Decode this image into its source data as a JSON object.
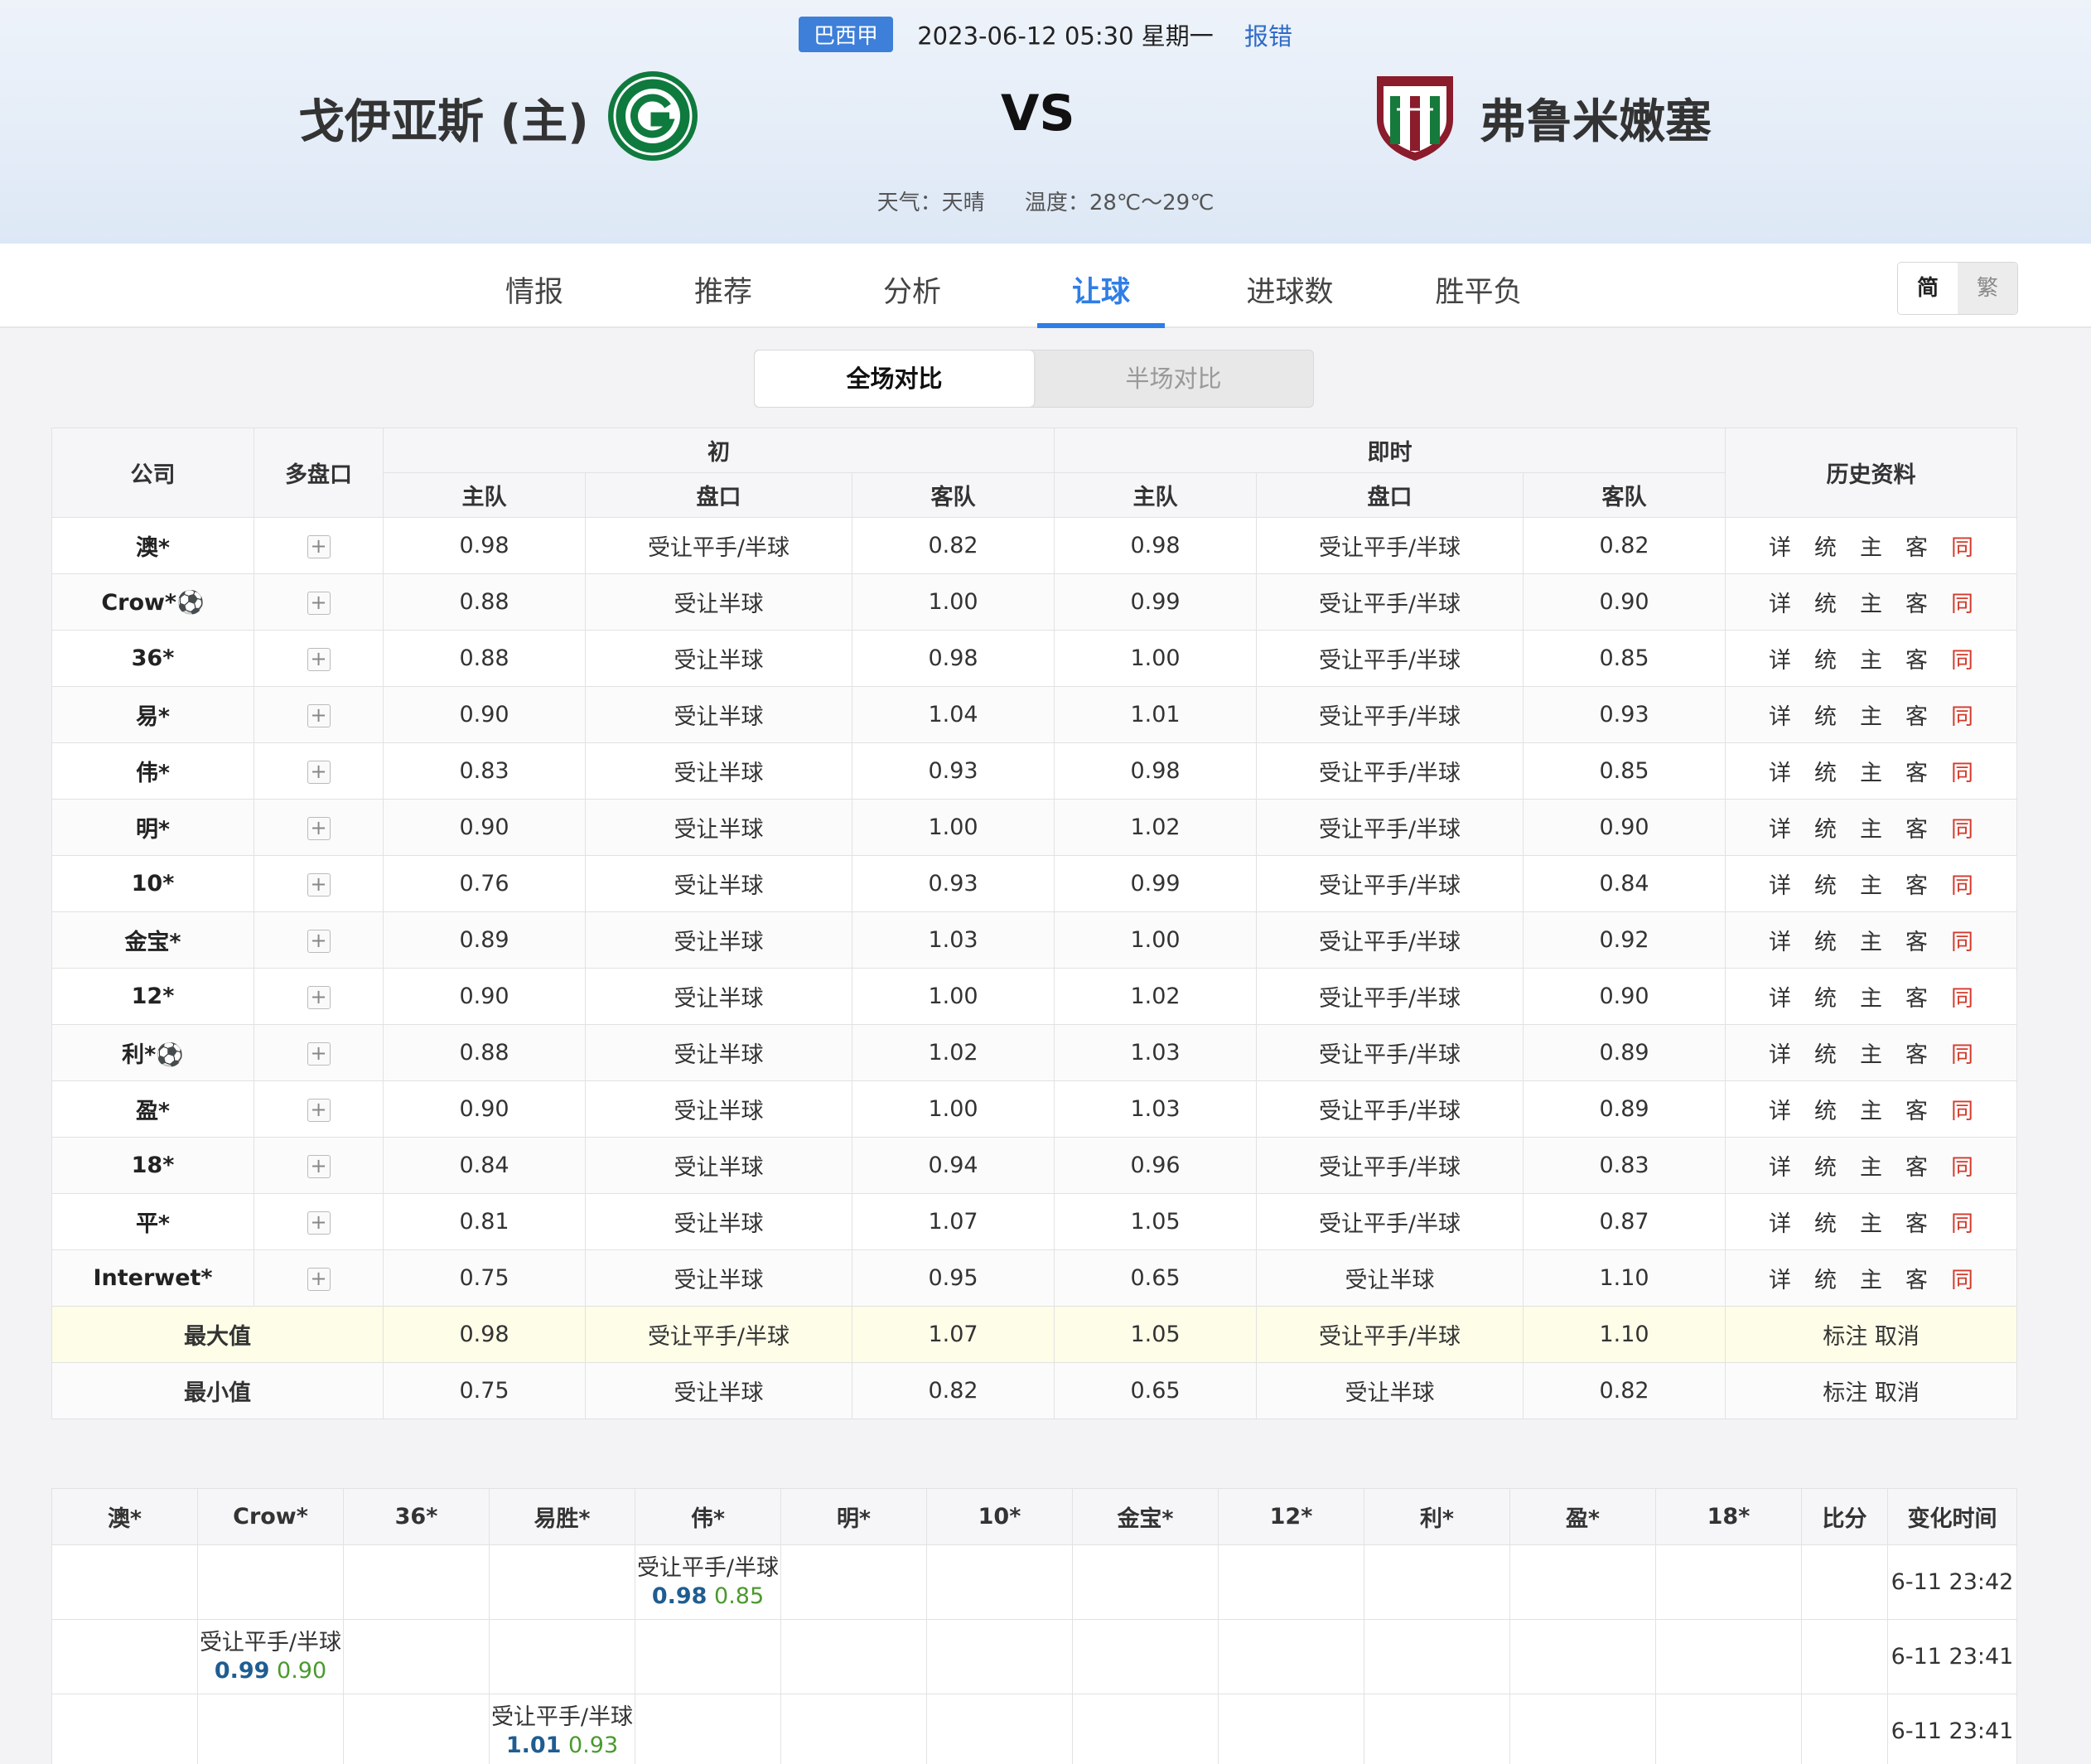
{
  "match": {
    "league": "巴西甲",
    "datetime": "2023-06-12 05:30 星期一",
    "report": "报错",
    "home": "戈伊亚斯 (主)",
    "vs": "VS",
    "away": "弗鲁米嫩塞",
    "weather": "天气：天晴",
    "temperature": "温度：28℃～29℃"
  },
  "tabs": [
    "情报",
    "推荐",
    "分析",
    "让球",
    "进球数",
    "胜平负"
  ],
  "active_tab": "让球",
  "lang": {
    "simplified": "简",
    "traditional": "繁"
  },
  "segments": {
    "full": "全场对比",
    "half": "半场对比"
  },
  "headers": {
    "company": "公司",
    "multi": "多盘口",
    "initial": "初",
    "live": "即时",
    "history": "历史资料",
    "home": "主队",
    "line": "盘口",
    "away": "客队"
  },
  "history_links": [
    "详",
    "统",
    "主",
    "客",
    "同"
  ],
  "rows": [
    {
      "company": "澳*",
      "i_home": "0.98",
      "i_line": "受让平手/半球",
      "i_away": "0.82",
      "l_home": "0.98",
      "l_line": "受让平手/半球",
      "l_away": "0.82"
    },
    {
      "company": "Crow*⚽",
      "i_home": "0.88",
      "i_line": "受让半球",
      "i_away": "1.00",
      "l_home": "0.99",
      "l_line": "受让平手/半球",
      "l_away": "0.90"
    },
    {
      "company": "36*",
      "i_home": "0.88",
      "i_line": "受让半球",
      "i_away": "0.98",
      "l_home": "1.00",
      "l_line": "受让平手/半球",
      "l_away": "0.85"
    },
    {
      "company": "易*",
      "i_home": "0.90",
      "i_line": "受让半球",
      "i_away": "1.04",
      "l_home": "1.01",
      "l_line": "受让平手/半球",
      "l_away": "0.93"
    },
    {
      "company": "伟*",
      "i_home": "0.83",
      "i_line": "受让半球",
      "i_away": "0.93",
      "l_home": "0.98",
      "l_line": "受让平手/半球",
      "l_away": "0.85"
    },
    {
      "company": "明*",
      "i_home": "0.90",
      "i_line": "受让半球",
      "i_away": "1.00",
      "l_home": "1.02",
      "l_line": "受让平手/半球",
      "l_away": "0.90"
    },
    {
      "company": "10*",
      "i_home": "0.76",
      "i_line": "受让半球",
      "i_away": "0.93",
      "l_home": "0.99",
      "l_line": "受让平手/半球",
      "l_away": "0.84"
    },
    {
      "company": "金宝*",
      "i_home": "0.89",
      "i_line": "受让半球",
      "i_away": "1.03",
      "l_home": "1.00",
      "l_line": "受让平手/半球",
      "l_away": "0.92"
    },
    {
      "company": "12*",
      "i_home": "0.90",
      "i_line": "受让半球",
      "i_away": "1.00",
      "l_home": "1.02",
      "l_line": "受让平手/半球",
      "l_away": "0.90"
    },
    {
      "company": "利*⚽",
      "i_home": "0.88",
      "i_line": "受让半球",
      "i_away": "1.02",
      "l_home": "1.03",
      "l_line": "受让平手/半球",
      "l_away": "0.89"
    },
    {
      "company": "盈*",
      "i_home": "0.90",
      "i_line": "受让半球",
      "i_away": "1.00",
      "l_home": "1.03",
      "l_line": "受让平手/半球",
      "l_away": "0.89"
    },
    {
      "company": "18*",
      "i_home": "0.84",
      "i_line": "受让半球",
      "i_away": "0.94",
      "l_home": "0.96",
      "l_line": "受让平手/半球",
      "l_away": "0.83"
    },
    {
      "company": "平*",
      "i_home": "0.81",
      "i_line": "受让半球",
      "i_away": "1.07",
      "l_home": "1.05",
      "l_line": "受让平手/半球",
      "l_away": "0.87"
    },
    {
      "company": "Interwet*",
      "i_home": "0.75",
      "i_line": "受让半球",
      "i_away": "0.95",
      "l_home": "0.65",
      "l_line": "受让半球",
      "l_away": "1.10"
    }
  ],
  "summary": [
    {
      "label": "最大值",
      "i_home": "0.98",
      "i_line": "受让平手/半球",
      "i_away": "1.07",
      "l_home": "1.05",
      "l_line": "受让平手/半球",
      "l_away": "1.10",
      "mark": "标注",
      "cancel": "取消"
    },
    {
      "label": "最小值",
      "i_home": "0.75",
      "i_line": "受让半球",
      "i_away": "0.82",
      "l_home": "0.65",
      "l_line": "受让半球",
      "l_away": "0.82",
      "mark": "标注",
      "cancel": "取消"
    }
  ],
  "change_headers": [
    "澳*",
    "Crow*",
    "36*",
    "易胜*",
    "伟*",
    "明*",
    "10*",
    "金宝*",
    "12*",
    "利*",
    "盈*",
    "18*",
    "比分",
    "变化时间"
  ],
  "changes": [
    {
      "col": 4,
      "line": "受让平手/半球",
      "home": "0.98",
      "away": "0.85",
      "time": "6-11 23:42"
    },
    {
      "col": 1,
      "line": "受让平手/半球",
      "home": "0.99",
      "away": "0.90",
      "time": "6-11 23:41"
    },
    {
      "col": 3,
      "line": "受让平手/半球",
      "home": "1.01",
      "away": "0.93",
      "time": "6-11 23:41"
    }
  ],
  "colors": {
    "accent": "#2f7ee6",
    "same_link": "#d43a2b",
    "change_home": "#1f5d91",
    "change_away": "#4a9a2e",
    "summary_bg": "#fdfde8"
  }
}
